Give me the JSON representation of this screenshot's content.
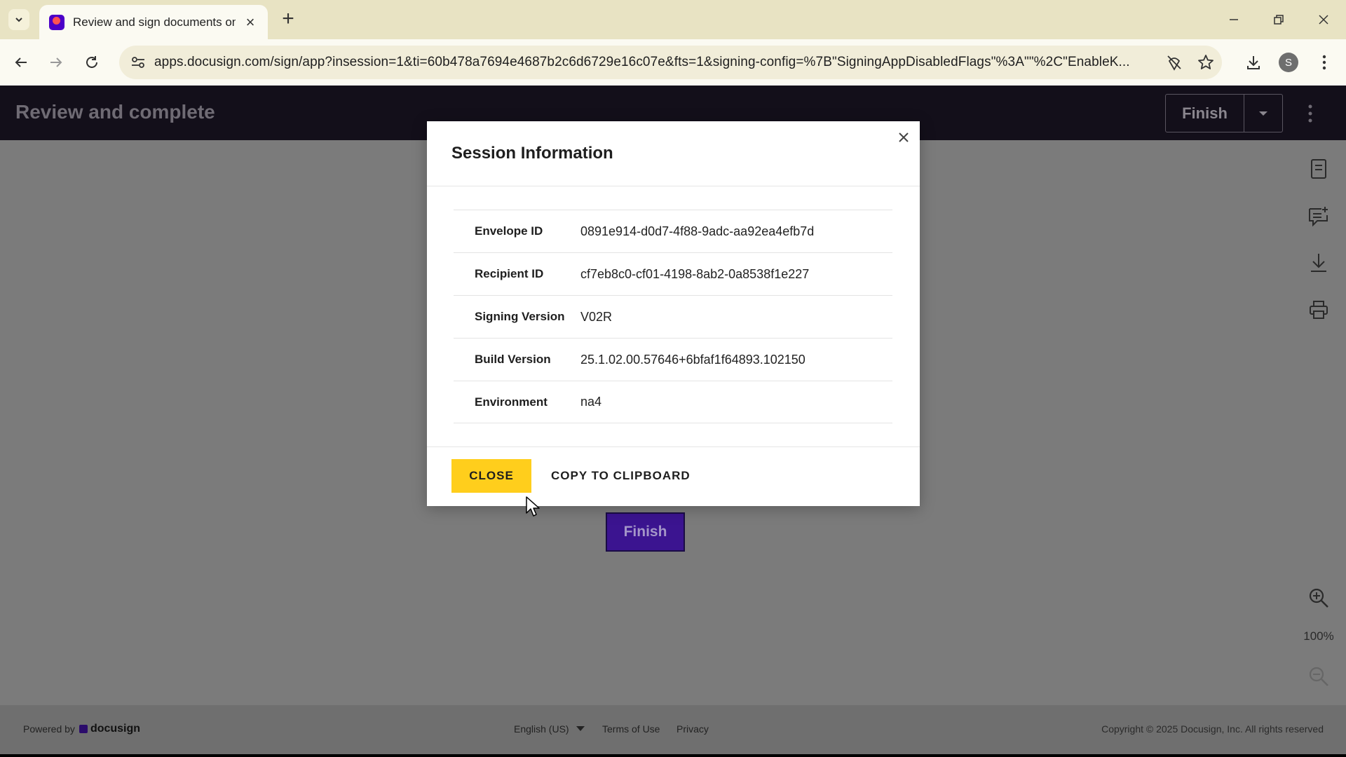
{
  "browser": {
    "tab": {
      "title": "Review and sign documents on"
    },
    "url": "apps.docusign.com/sign/app?insession=1&ti=60b478a7694e4687b2c6d6729e16c07e&fts=1&signing-config=%7B\"SigningAppDisabledFlags\"%3A\"\"%2C\"EnableK...",
    "profile_initial": "S"
  },
  "header": {
    "title": "Review and complete",
    "finish_label": "Finish"
  },
  "document": {
    "finish_label": "Finish"
  },
  "side_tools": {
    "zoom_level": "100%"
  },
  "modal": {
    "title": "Session Information",
    "rows": [
      {
        "label": "Envelope ID",
        "value": "0891e914-d0d7-4f88-9adc-aa92ea4efb7d"
      },
      {
        "label": "Recipient ID",
        "value": "cf7eb8c0-cf01-4198-8ab2-0a8538f1e227"
      },
      {
        "label": "Signing Version",
        "value": "V02R"
      },
      {
        "label": "Build Version",
        "value": "25.1.02.00.57646+6bfaf1f64893.102150"
      },
      {
        "label": "Environment",
        "value": "na4"
      }
    ],
    "close_label": "CLOSE",
    "copy_label": "COPY TO CLIPBOARD"
  },
  "footer": {
    "powered_by": "Powered by",
    "brand": "docusign",
    "language": "English (US)",
    "terms": "Terms of Use",
    "privacy": "Privacy",
    "copyright": "Copyright © 2025 Docusign, Inc. All rights reserved"
  },
  "colors": {
    "accent_yellow": "#ffce1c",
    "finish_purple": "#3b1490",
    "header_dark": "#130f1a"
  }
}
